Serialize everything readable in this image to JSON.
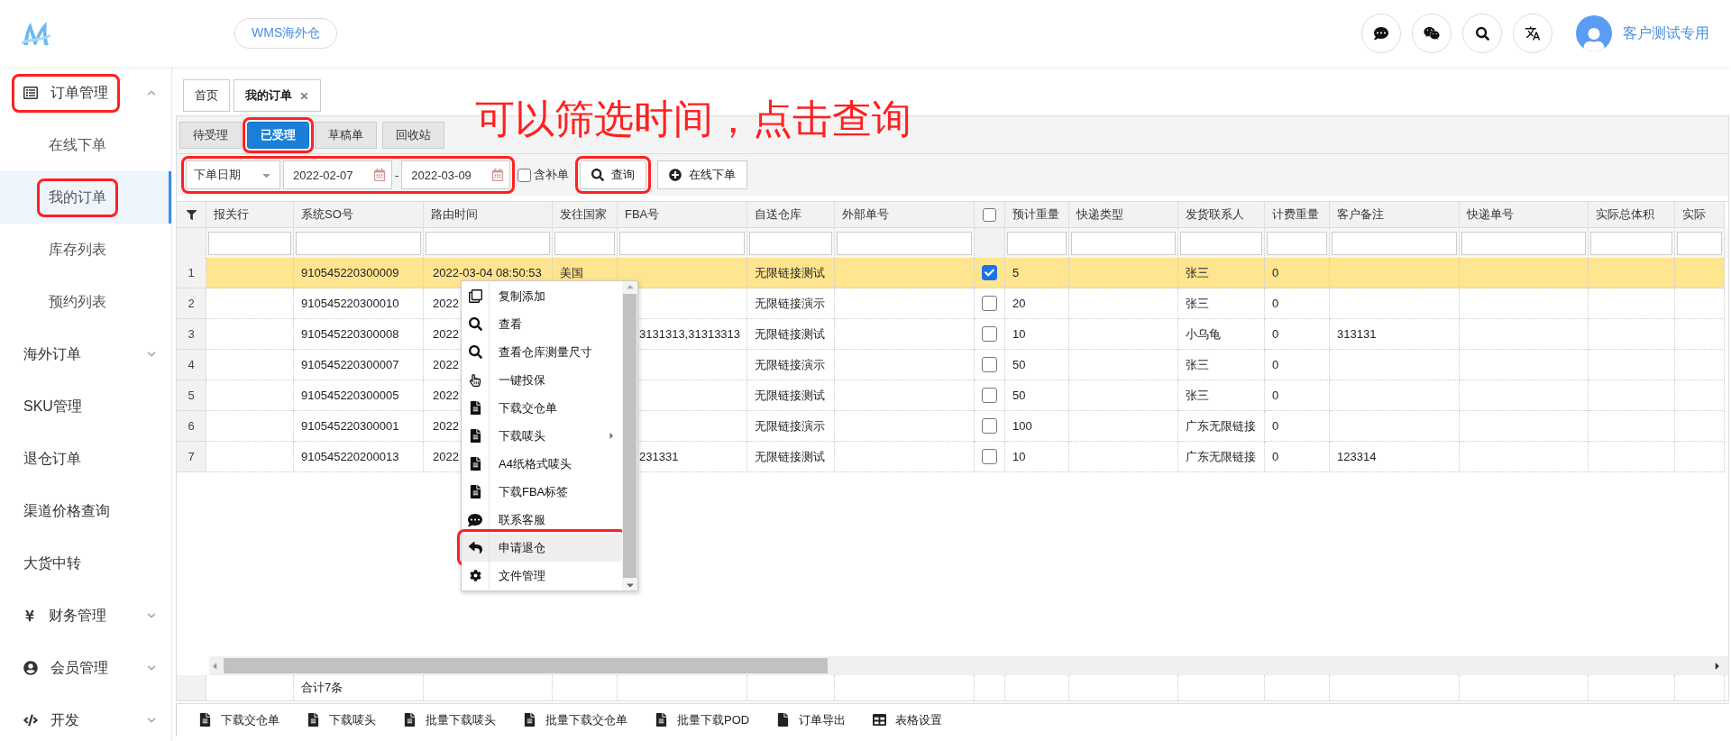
{
  "header": {
    "app_pill": "WMS海外仓",
    "user_name": "客户测试专用"
  },
  "sidebar": {
    "items": [
      {
        "label": "订单管理",
        "kind": "orders",
        "expanded": true,
        "annotated": true,
        "selected": false,
        "children": [
          {
            "label": "在线下单",
            "selected": false,
            "annotated": false
          },
          {
            "label": "我的订单",
            "selected": true,
            "annotated": true
          },
          {
            "label": "库存列表",
            "selected": false,
            "annotated": false
          },
          {
            "label": "预约列表",
            "selected": false,
            "annotated": false
          }
        ]
      },
      {
        "label": "海外订单",
        "kind": "plain",
        "expanded": false,
        "annotated": false,
        "selected": false
      },
      {
        "label": "SKU管理",
        "kind": "plain",
        "annotated": false,
        "selected": false
      },
      {
        "label": "退仓订单",
        "kind": "plain",
        "annotated": false,
        "selected": false
      },
      {
        "label": "渠道价格查询",
        "kind": "plain",
        "annotated": false,
        "selected": false
      },
      {
        "label": "大货中转",
        "kind": "plain",
        "annotated": false,
        "selected": false
      },
      {
        "label": "财务管理",
        "kind": "finance",
        "expanded": false,
        "annotated": false,
        "selected": false
      },
      {
        "label": "会员管理",
        "kind": "member",
        "expanded": false,
        "annotated": false,
        "selected": false
      },
      {
        "label": "开发",
        "kind": "dev",
        "expanded": false,
        "annotated": false,
        "selected": false
      }
    ]
  },
  "page_tabs": [
    {
      "label": "首页",
      "selected": false,
      "closable": false
    },
    {
      "label": "我的订单",
      "selected": true,
      "closable": true
    }
  ],
  "annotation": "可以筛选时间，点击查询",
  "status_tabs": [
    {
      "label": "待受理",
      "selected": false,
      "annotated": false
    },
    {
      "label": "已受理",
      "selected": true,
      "annotated": true
    },
    {
      "label": "草稿单",
      "selected": false,
      "annotated": false
    },
    {
      "label": "回收站",
      "selected": false,
      "annotated": false
    }
  ],
  "filters": {
    "annotated": true,
    "date_type": "下单日期",
    "date_from": "2022-02-07",
    "separator": "-",
    "date_to": "2022-03-09",
    "supplement": {
      "label": "含补单",
      "checked": false
    },
    "buttons": [
      {
        "label": "查询",
        "kind": "search",
        "annotated": true
      },
      {
        "label": "在线下单",
        "kind": "add",
        "annotated": false
      }
    ]
  },
  "table": {
    "select_all": {
      "checked": false
    },
    "columns": [
      {
        "kind": "rownum"
      },
      {
        "kind": "text",
        "label": "报关行"
      },
      {
        "kind": "text",
        "label": "系统SO号"
      },
      {
        "kind": "text",
        "label": "路由时间"
      },
      {
        "kind": "text",
        "label": "发往国家"
      },
      {
        "kind": "text",
        "label": "FBA号"
      },
      {
        "kind": "text",
        "label": "自送仓库"
      },
      {
        "kind": "text",
        "label": "外部单号"
      },
      {
        "kind": "check"
      },
      {
        "kind": "text",
        "label": "预计重量"
      },
      {
        "kind": "text",
        "label": "快递类型"
      },
      {
        "kind": "text",
        "label": "发货联系人"
      },
      {
        "kind": "text",
        "label": "计费重量"
      },
      {
        "kind": "text",
        "label": "客户备注"
      },
      {
        "kind": "text",
        "label": "快递单号"
      },
      {
        "kind": "text",
        "label": "实际总体积"
      },
      {
        "kind": "text",
        "label": "实际"
      }
    ],
    "rows": [
      {
        "selected": true,
        "checked": true,
        "cells": [
          "1",
          "",
          "910545220300009",
          "2022-03-04 08:50:53",
          "美国",
          "",
          "无限链接测试",
          "",
          "",
          "5",
          "",
          "张三",
          "0",
          "",
          "",
          "",
          ""
        ]
      },
      {
        "selected": false,
        "checked": false,
        "cells": [
          "2",
          "",
          "910545220300010",
          "2022",
          "",
          "",
          "无限链接演示",
          "",
          "",
          "20",
          "",
          "张三",
          "0",
          "",
          "",
          "",
          ""
        ]
      },
      {
        "selected": false,
        "checked": false,
        "cells": [
          "3",
          "",
          "910545220300008",
          "2022",
          "",
          "3131313,31313313",
          "无限链接测试",
          "",
          "",
          "10",
          "",
          "小乌龟",
          "0",
          "313131",
          "",
          "",
          ""
        ]
      },
      {
        "selected": false,
        "checked": false,
        "cells": [
          "4",
          "",
          "910545220300007",
          "2022",
          "",
          "",
          "无限链接演示",
          "",
          "",
          "50",
          "",
          "张三",
          "0",
          "",
          "",
          "",
          ""
        ]
      },
      {
        "selected": false,
        "checked": false,
        "cells": [
          "5",
          "",
          "910545220300005",
          "2022",
          "",
          "",
          "无限链接测试",
          "",
          "",
          "50",
          "",
          "张三",
          "0",
          "",
          "",
          "",
          ""
        ]
      },
      {
        "selected": false,
        "checked": false,
        "cells": [
          "6",
          "",
          "910545220300001",
          "2022",
          "",
          "",
          "无限链接演示",
          "",
          "",
          "100",
          "",
          "广东无限链接",
          "0",
          "",
          "",
          "",
          ""
        ]
      },
      {
        "selected": false,
        "checked": false,
        "cells": [
          "7",
          "",
          "910545220200013",
          "2022",
          "",
          "231331",
          "无限链接测试",
          "",
          "",
          "10",
          "",
          "广东无限链接",
          "0",
          "123314",
          "",
          "",
          ""
        ]
      }
    ],
    "footer": {
      "total": "合计7条"
    }
  },
  "context_menu": {
    "items": [
      {
        "label": "复制添加",
        "kind": "copy",
        "selected": false,
        "submenu": false,
        "annotated": false
      },
      {
        "label": "查看",
        "kind": "view",
        "selected": false,
        "submenu": false,
        "annotated": false
      },
      {
        "label": "查看仓库测量尺寸",
        "kind": "view",
        "selected": false,
        "submenu": false,
        "annotated": false
      },
      {
        "label": "一键投保",
        "kind": "hand",
        "selected": false,
        "submenu": false,
        "annotated": false
      },
      {
        "label": "下载交仓单",
        "kind": "doc",
        "selected": false,
        "submenu": false,
        "annotated": false
      },
      {
        "label": "下载唛头",
        "kind": "doc",
        "selected": false,
        "submenu": true,
        "annotated": false
      },
      {
        "label": "A4纸格式唛头",
        "kind": "doc",
        "selected": false,
        "submenu": false,
        "annotated": false
      },
      {
        "label": "下载FBA标签",
        "kind": "doc",
        "selected": false,
        "submenu": false,
        "annotated": false
      },
      {
        "label": "联系客服",
        "kind": "chat",
        "selected": false,
        "submenu": false,
        "annotated": false
      },
      {
        "label": "申请退仓",
        "kind": "return",
        "selected": true,
        "submenu": false,
        "annotated": true
      },
      {
        "label": "文件管理",
        "kind": "settings",
        "selected": false,
        "submenu": false,
        "annotated": false
      }
    ]
  },
  "bottom_toolbar": [
    {
      "label": "下载交仓单",
      "kind": "doc"
    },
    {
      "label": "下载唛头",
      "kind": "doc"
    },
    {
      "label": "批量下载唛头",
      "kind": "doc"
    },
    {
      "label": "批量下载交仓单",
      "kind": "doc"
    },
    {
      "label": "批量下载POD",
      "kind": "doc"
    },
    {
      "label": "订单导出",
      "kind": "file"
    },
    {
      "label": "表格设置",
      "kind": "table"
    }
  ]
}
